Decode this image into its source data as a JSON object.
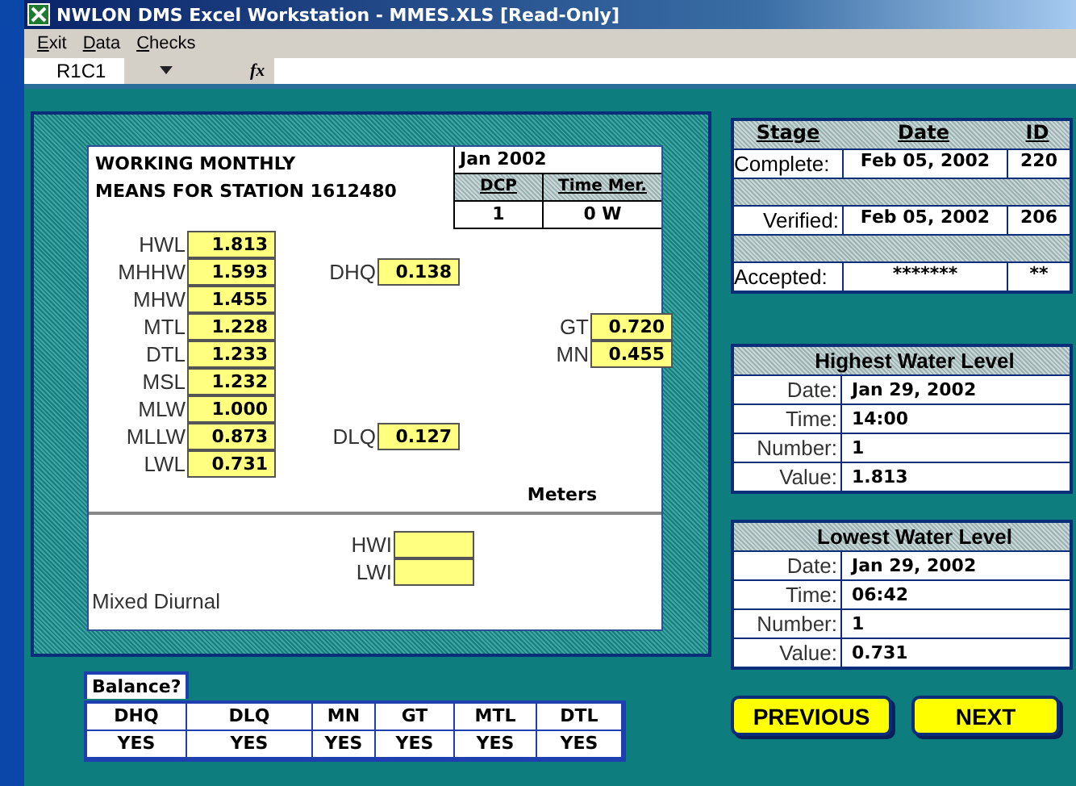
{
  "window": {
    "title": "NWLON DMS Excel Workstation - MMES.XLS  [Read-Only]"
  },
  "menu": [
    "Exit",
    "Data",
    "Checks"
  ],
  "formula_bar": {
    "name_box": "R1C1",
    "function_label": "fx"
  },
  "sheet": {
    "title_lines": [
      "WORKING MONTHLY",
      "MEANS FOR STATION 1612480"
    ],
    "month": "Jan 2002",
    "dcp_header": "DCP",
    "time_meridian_header": "Time Mer.",
    "dcp": "1",
    "time_meridian": "0 W",
    "datums": [
      {
        "label": "HWL",
        "value": "1.813"
      },
      {
        "label": "MHHW",
        "value": "1.593"
      },
      {
        "label": "MHW",
        "value": "1.455"
      },
      {
        "label": "MTL",
        "value": "1.228"
      },
      {
        "label": "DTL",
        "value": "1.233"
      },
      {
        "label": "MSL",
        "value": "1.232"
      },
      {
        "label": "MLW",
        "value": "1.000"
      },
      {
        "label": "MLLW",
        "value": "0.873"
      },
      {
        "label": "LWL",
        "value": "0.731"
      }
    ],
    "inequalities": [
      {
        "label": "DHQ",
        "value": "0.138"
      },
      {
        "label": "DLQ",
        "value": "0.127"
      }
    ],
    "ranges": [
      {
        "label": "GT",
        "value": "0.720"
      },
      {
        "label": "MN",
        "value": "0.455"
      }
    ],
    "units": "Meters",
    "intervals": [
      {
        "label": "HWI"
      },
      {
        "label": "LWI"
      }
    ],
    "tide_type": "Mixed Diurnal"
  },
  "stages": {
    "columns": [
      "Stage",
      "Date",
      "ID"
    ],
    "rows": [
      {
        "stage": "Complete:",
        "date": "Feb 05, 2002",
        "id": "220"
      },
      {
        "stage": "Verified:",
        "date": "Feb 05, 2002",
        "id": "206"
      },
      {
        "stage": "Accepted:",
        "date": "*******",
        "id": "**"
      }
    ]
  },
  "extremes": [
    {
      "title": "Highest Water Level",
      "rows": [
        {
          "label": "Date:",
          "value": "Jan 29, 2002"
        },
        {
          "label": "Time:",
          "value": "14:00"
        },
        {
          "label": "Number:",
          "value": "1"
        },
        {
          "label": "Value:",
          "value": "1.813"
        }
      ]
    },
    {
      "title": "Lowest Water Level",
      "rows": [
        {
          "label": "Date:",
          "value": "Jan 29, 2002"
        },
        {
          "label": "Time:",
          "value": "06:42"
        },
        {
          "label": "Number:",
          "value": "1"
        },
        {
          "label": "Value:",
          "value": "0.731"
        }
      ]
    }
  ],
  "balance": {
    "title": "Balance?",
    "columns": [
      "DHQ",
      "DLQ",
      "MN",
      "GT",
      "MTL",
      "DTL"
    ],
    "values": [
      "YES",
      "YES",
      "YES",
      "YES",
      "YES",
      "YES"
    ]
  },
  "buttons": [
    "PREVIOUS",
    "NEXT"
  ]
}
